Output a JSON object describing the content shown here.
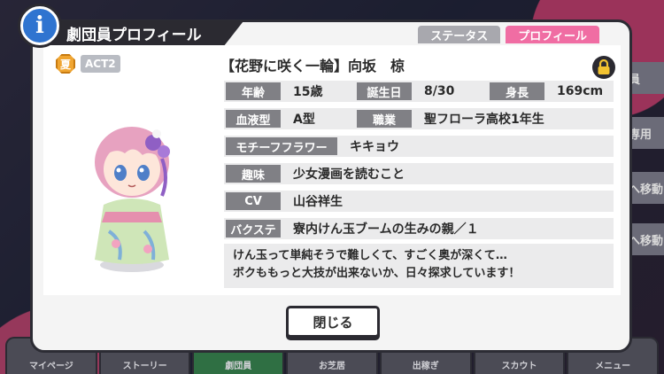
{
  "dialog": {
    "title": "劇団員プロフィール",
    "info_icon_glyph": "i",
    "tabs": [
      {
        "label": "ステータス",
        "active": false
      },
      {
        "label": "プロフィール",
        "active": true
      }
    ],
    "close_label": "閉じる"
  },
  "character": {
    "season_badge": "夏",
    "act_badge": "ACT2",
    "name": "【花野に咲く一輪】向坂　椋",
    "age_label": "年齢",
    "age": "15歳",
    "birthday_label": "誕生日",
    "birthday": "8/30",
    "height_label": "身長",
    "height": "169cm",
    "blood_label": "血液型",
    "blood": "A型",
    "job_label": "職業",
    "job": "聖フローラ高校1年生",
    "flower_label": "モチーフフラワー",
    "flower": "キキョウ",
    "hobby_label": "趣味",
    "hobby": "少女漫画を読むこと",
    "cv_label": "CV",
    "cv": "山谷祥生",
    "bakuste_label": "バクステ",
    "bakuste": "寮内けん玉ブームの生みの親／１",
    "quote_line1": "けん玉って単純そうで難しくて、すごく奥が深くて…",
    "quote_line2": "ボクももっと大技が出来ないか、日々探求しています！"
  },
  "background": {
    "side_labels": [
      "員",
      "専用",
      "へ移動",
      "へ移動"
    ],
    "nav": [
      "マイページ",
      "ストーリー",
      "劇団員",
      "お芝居",
      "出稼ぎ",
      "スカウト",
      "メニュー"
    ],
    "active_nav": "劇団員"
  },
  "colors": {
    "accent_pink": "#f06da3",
    "badge_blue": "#2f74d0",
    "season_orange": "#f0a531",
    "label_gray": "#808085",
    "dark": "#2b2a31"
  }
}
